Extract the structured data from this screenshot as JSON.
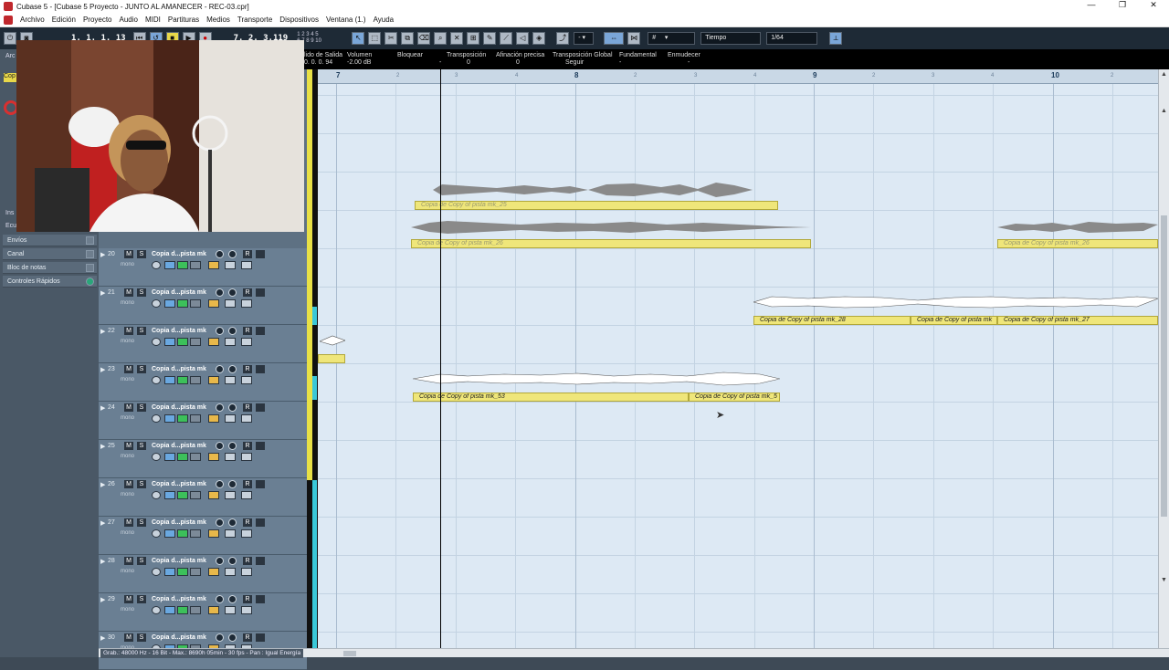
{
  "window": {
    "title": "Cubase 5 - [Cubase 5 Proyecto - JUNTO AL AMANECER - REC-03.cpr]",
    "controls": [
      "—",
      "❐",
      "✕"
    ]
  },
  "menu": [
    "Archivo",
    "Edición",
    "Proyecto",
    "Audio",
    "MIDI",
    "Partituras",
    "Medios",
    "Transporte",
    "Dispositivos",
    "Ventana (1.)",
    "Ayuda"
  ],
  "toolbar": {
    "left_locator": "1. 1. 1. 13",
    "position": "7. 2. 3.119",
    "snap_type": "Tiempo",
    "quantize": "1/64",
    "numbers_top": "1 2 3 4 5",
    "numbers_bot": "6 7 8 9 10"
  },
  "infoline": [
    {
      "label": "lido de Salida",
      "value": "0. 0. 0. 94"
    },
    {
      "label": "Volumen",
      "value": "-2.00 dB"
    },
    {
      "label": "Bloquear",
      "value": "-"
    },
    {
      "label": "Transposición",
      "value": "0"
    },
    {
      "label": "Afinación precisa",
      "value": "0"
    },
    {
      "label": "Transposición Global",
      "value": "Seguir"
    },
    {
      "label": "Fundamental",
      "value": "-"
    },
    {
      "label": "Enmudecer",
      "value": "-"
    }
  ],
  "inspector": {
    "partial_labels": [
      "Arc",
      "Cop",
      "Ins",
      "Ecu"
    ],
    "items": [
      "Envíos",
      "Canal",
      "Bloc de notas",
      "Controles Rápidos"
    ]
  },
  "tracks": [
    {
      "num": "20",
      "name": "Copia d...pista mk",
      "mono": "mono"
    },
    {
      "num": "21",
      "name": "Copia d...pista mk",
      "mono": "mono"
    },
    {
      "num": "22",
      "name": "Copia d...pista mk",
      "mono": "mono"
    },
    {
      "num": "23",
      "name": "Copia d...pista mk",
      "mono": "mono"
    },
    {
      "num": "24",
      "name": "Copia d...pista mk",
      "mono": "mono"
    },
    {
      "num": "25",
      "name": "Copia d...pista mk",
      "mono": "mono"
    },
    {
      "num": "26",
      "name": "Copia d...pista mk",
      "mono": "mono"
    },
    {
      "num": "27",
      "name": "Copia d...pista mk",
      "mono": "mono"
    },
    {
      "num": "28",
      "name": "Copia d...pista mk",
      "mono": "mono"
    },
    {
      "num": "29",
      "name": "Copia d...pista mk",
      "mono": "mono"
    },
    {
      "num": "30",
      "name": "Copia d...pista mk",
      "mono": "mono"
    }
  ],
  "track_buttons": {
    "mute": "M",
    "solo": "S",
    "read": "R",
    "edit": "e"
  },
  "ruler": {
    "bars": [
      "7",
      "8",
      "9",
      "10"
    ],
    "beats": [
      "2",
      "3",
      "4"
    ]
  },
  "clips": [
    {
      "label": "Copia de Copy of pista mk_25"
    },
    {
      "label": "Copia de Copy of pista mk_26"
    },
    {
      "label": "Copia de Copy of pista mk_26"
    },
    {
      "label": "Copia de Copy of pista mk_28"
    },
    {
      "label": "Copia de Copy of pista mk"
    },
    {
      "label": "Copia de Copy of pista mk_27"
    },
    {
      "label": "Copia de Copy of pista mk_53"
    },
    {
      "label": "Copia de Copy of pista mk_5"
    }
  ],
  "status": "Grab.: 48000 Hz - 16 Bit - Max.: 8690h 05min - 30 fps - Pan : Igual Energía"
}
